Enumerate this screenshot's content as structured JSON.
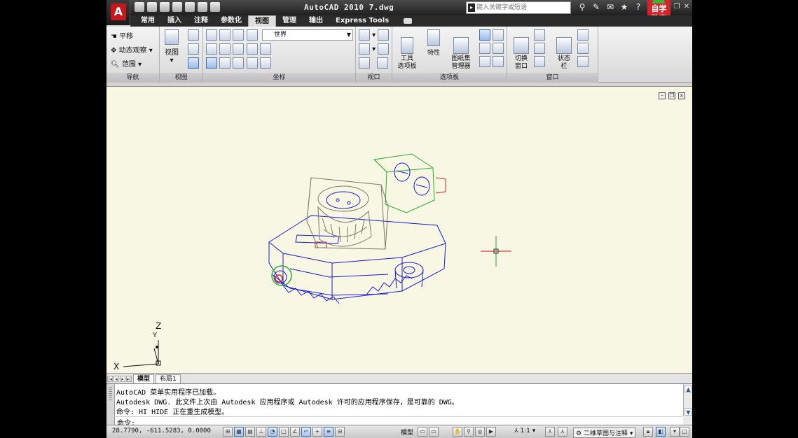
{
  "colors": {
    "chrome_dark": "#1f1f1f",
    "ribbon": "#e6e6e6",
    "drawing_bg": "#f8f7e4",
    "model_blue": "#1a1ad6",
    "model_green": "#28b028",
    "model_gray": "#7a7a6a",
    "brand_red": "#c8161d",
    "crosshair": "#c81818"
  },
  "titlebar": {
    "app_logo": "A",
    "title": "AutoCAD 2010  7.dwg",
    "search_placeholder": "键入关键字或短语",
    "watermark": "自学教育"
  },
  "tabs": [
    {
      "label": "常用"
    },
    {
      "label": "插入"
    },
    {
      "label": "注释"
    },
    {
      "label": "参数化"
    },
    {
      "label": "视图",
      "active": true
    },
    {
      "label": "管理"
    },
    {
      "label": "输出"
    },
    {
      "label": "Express Tools"
    }
  ],
  "ribbon": {
    "nav": {
      "pan": "平移",
      "orbit": "动态观察",
      "extents": "范围",
      "title": "导航"
    },
    "view": {
      "label": "视图",
      "title": "视图"
    },
    "coords": {
      "ucs_combo": "世界",
      "title": "坐标"
    },
    "viewports": {
      "title": "视口"
    },
    "palettes": {
      "tool_palettes": "工具\n选项板",
      "properties": "特性",
      "sheetset": "图纸集\n管理器",
      "title": "选项板"
    },
    "window": {
      "switch": "切换\n窗口",
      "statusbar": "状态\n栏",
      "title": "窗口"
    }
  },
  "layout_tabs": [
    {
      "label": "模型",
      "active": true
    },
    {
      "label": "布局1"
    }
  ],
  "command_history": [
    "AutoCAD 菜单实用程序已加载。",
    "Autodesk DWG.   此文件上次由 Autodesk 应用程序或 Autodesk 许可的应用程序保存，是可靠的 DWG。",
    "命令: HI HIDE 正在重生成模型。"
  ],
  "command_prompt": "命令:",
  "ucs": {
    "x": "X",
    "y": "Y",
    "z": "Z"
  },
  "statusbar": {
    "coords": "28.7790, -611.5283, 0.0000",
    "model": "模型",
    "scale": "1:1",
    "workspace": "二维草图与注释"
  }
}
